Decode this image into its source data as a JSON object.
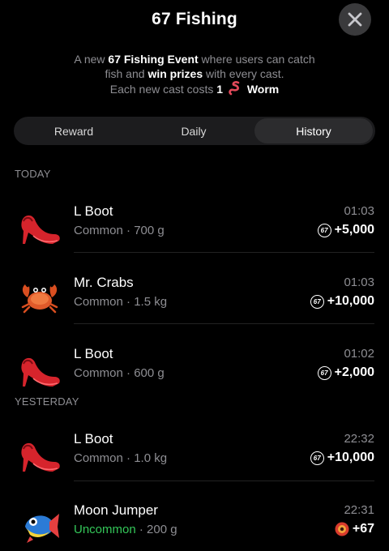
{
  "header": {
    "title": "67 Fishing"
  },
  "description": {
    "line1_pre": "A new ",
    "line1_bold": "67 Fishing Event",
    "line1_post": " where users can catch",
    "line2_pre": "fish and ",
    "line2_bold": "win prizes",
    "line2_post": " with every cast.",
    "line3_pre": "Each new cast costs ",
    "line3_bold": "1",
    "line3_unit": "Worm"
  },
  "tabs": [
    {
      "label": "Reward",
      "active": false
    },
    {
      "label": "Daily",
      "active": false
    },
    {
      "label": "History",
      "active": true
    }
  ],
  "sections": {
    "today": "TODAY",
    "yesterday": "YESTERDAY"
  },
  "history": [
    {
      "name": "L Boot",
      "rarity": "Common",
      "weight": "700 g",
      "time": "01:03",
      "reward": "+5,000",
      "icon": "heel-icon",
      "coin": "67-coin-icon"
    },
    {
      "name": "Mr. Crabs",
      "rarity": "Common",
      "weight": "1.5 kg",
      "time": "01:03",
      "reward": "+10,000",
      "icon": "crab-icon",
      "coin": "67-coin-icon"
    },
    {
      "name": "L Boot",
      "rarity": "Common",
      "weight": "600 g",
      "time": "01:02",
      "reward": "+2,000",
      "icon": "heel-icon",
      "coin": "67-coin-icon"
    },
    {
      "name": "L Boot",
      "rarity": "Common",
      "weight": "1.0 kg",
      "time": "22:32",
      "reward": "+10,000",
      "icon": "heel-icon",
      "coin": "67-coin-icon"
    },
    {
      "name": "Moon Jumper",
      "rarity": "Uncommon",
      "weight": "200 g",
      "time": "22:31",
      "reward": "+67",
      "icon": "fish-icon",
      "coin": "token-icon"
    }
  ],
  "meta_separator": " · ",
  "coin_label": "67",
  "colors": {
    "background": "#000000",
    "uncommon": "#34c759",
    "secondary_text": "#8e8e93",
    "tab_bg": "#1c1c1e",
    "tab_active": "#2c2c2e"
  }
}
